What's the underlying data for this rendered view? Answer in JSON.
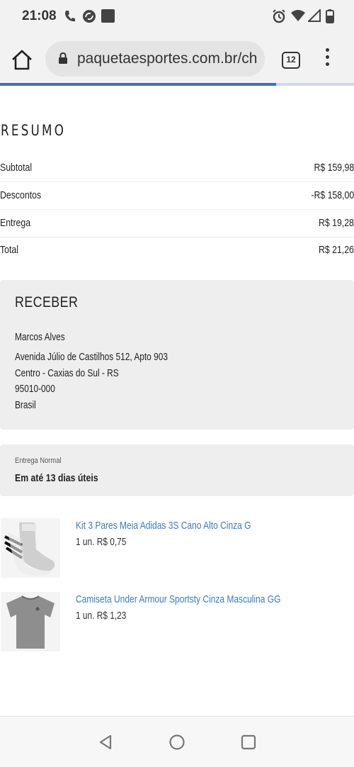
{
  "status_bar": {
    "time": "21:08",
    "icons": [
      "phone-icon",
      "sync-icon",
      "notification-square-icon",
      "alarm-icon",
      "wifi-icon",
      "signal-icon",
      "battery-icon"
    ]
  },
  "browser": {
    "url": "paquetaesportes.com.br/ch",
    "tab_count": "12",
    "page_load_progress": 0.78
  },
  "summary": {
    "title": "RESUMO",
    "rows": [
      {
        "label": "Subtotal",
        "value": "R$ 159,98"
      },
      {
        "label": "Descontos",
        "value": "-R$ 158,00"
      },
      {
        "label": "Entrega",
        "value": "R$ 19,28"
      },
      {
        "label": "Total",
        "value": "R$ 21,26"
      }
    ]
  },
  "receiver": {
    "title": "RECEBER",
    "name": "Marcos Alves",
    "street": "Avenida Júlio de Castilhos 512, Apto 903",
    "district": "Centro - Caxias do Sul - RS",
    "zip": "95010-000",
    "country": "Brasil"
  },
  "shipping": {
    "type": "Entrega Normal",
    "eta": "Em até 13 dias úteis"
  },
  "products": [
    {
      "name": "Kit 3 Pares Meia Adidas 3S Cano Alto Cinza G",
      "price": "1 un. R$ 0,75",
      "image": "socks-image"
    },
    {
      "name": "Camiseta Under Armour Sportsty Cinza Masculina GG",
      "price": "1 un. R$ 1,23",
      "image": "tshirt-image"
    }
  ],
  "colors": {
    "accent": "#3d6fc4",
    "link": "#3a7bbf",
    "panel": "#eeeeee"
  }
}
